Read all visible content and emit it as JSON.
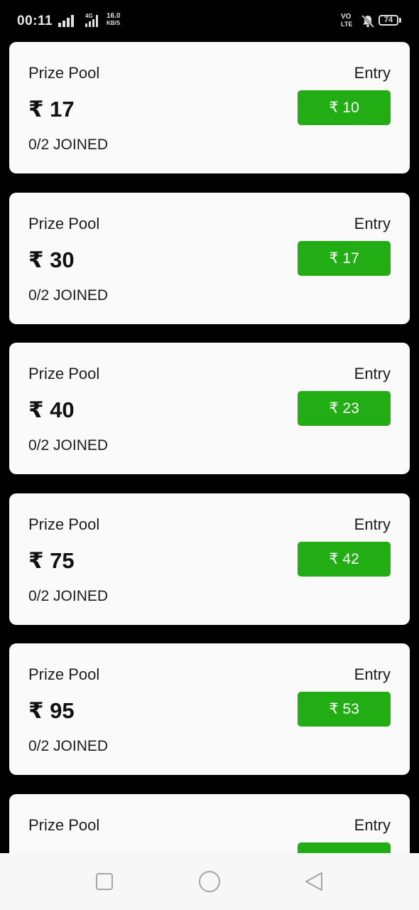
{
  "status_bar": {
    "time": "00:11",
    "network_type": "4G",
    "speed_value": "16.0",
    "speed_unit": "KB/S",
    "volte_top": "VO",
    "volte_bottom": "LTE",
    "battery": "74"
  },
  "contests": [
    {
      "prize_label": "Prize Pool",
      "prize": "₹ 17",
      "entry_label": "Entry",
      "entry_fee": "₹ 10",
      "joined": "0/2 JOINED"
    },
    {
      "prize_label": "Prize Pool",
      "prize": "₹ 30",
      "entry_label": "Entry",
      "entry_fee": "₹ 17",
      "joined": "0/2 JOINED"
    },
    {
      "prize_label": "Prize Pool",
      "prize": "₹ 40",
      "entry_label": "Entry",
      "entry_fee": "₹ 23",
      "joined": "0/2 JOINED"
    },
    {
      "prize_label": "Prize Pool",
      "prize": "₹ 75",
      "entry_label": "Entry",
      "entry_fee": "₹ 42",
      "joined": "0/2 JOINED"
    },
    {
      "prize_label": "Prize Pool",
      "prize": "₹ 95",
      "entry_label": "Entry",
      "entry_fee": "₹ 53",
      "joined": "0/2 JOINED"
    },
    {
      "prize_label": "Prize Pool",
      "prize": "",
      "entry_label": "Entry",
      "entry_fee": "",
      "joined": ""
    }
  ],
  "navigation": {
    "recent_apps": "square-icon",
    "home": "circle-icon",
    "back": "triangle-back-icon"
  },
  "colors": {
    "background": "#000000",
    "card": "#fafafa",
    "entry_button": "#22ad14",
    "nav_bar": "#f7f7f7"
  }
}
